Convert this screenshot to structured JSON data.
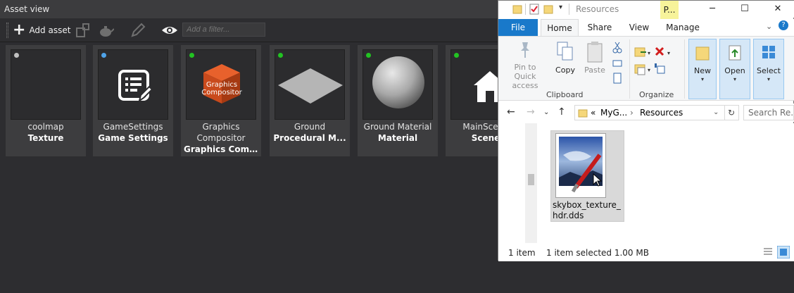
{
  "asset_view": {
    "title": "Asset view",
    "toolbar": {
      "add_asset_label": "Add asset",
      "filter_placeholder": "Add a filter..."
    },
    "assets": [
      {
        "name": "coolmap",
        "type": "Texture",
        "status_color": "#c0c0c0"
      },
      {
        "name": "GameSettings",
        "type": "Game Settings",
        "status_color": "#4fa3e8"
      },
      {
        "name_line1": "Graphics",
        "name_line2": "Compositor",
        "type": "Graphics Com...",
        "thumb_text": "Graphics Compositor",
        "status_color": "#22c322"
      },
      {
        "name": "Ground",
        "type": "Procedural M...",
        "status_color": "#22c322"
      },
      {
        "name": "Ground Material",
        "type": "Material",
        "status_color": "#22c322"
      },
      {
        "name": "MainScene",
        "type": "Scene",
        "status_color": "#22c322"
      }
    ]
  },
  "explorer": {
    "title": "Resources",
    "context_tab": "P...",
    "tabs": {
      "file": "File",
      "home": "Home",
      "share": "Share",
      "view": "View",
      "manage": "Manage"
    },
    "ribbon": {
      "pin_label_1": "Pin to Quick",
      "pin_label_2": "access",
      "copy_label": "Copy",
      "paste_label": "Paste",
      "clipboard_group": "Clipboard",
      "organize_group": "Organize",
      "new_label": "New",
      "open_label": "Open",
      "select_label": "Select"
    },
    "address": {
      "prefix": "«",
      "parent": "MyG...",
      "separator": "›",
      "current": "Resources"
    },
    "search_placeholder": "Search Re...",
    "file": {
      "name": "skybox_texture_hdr.dds"
    },
    "status": {
      "count": "1 item",
      "selected": "1 item selected  1.00 MB"
    }
  }
}
